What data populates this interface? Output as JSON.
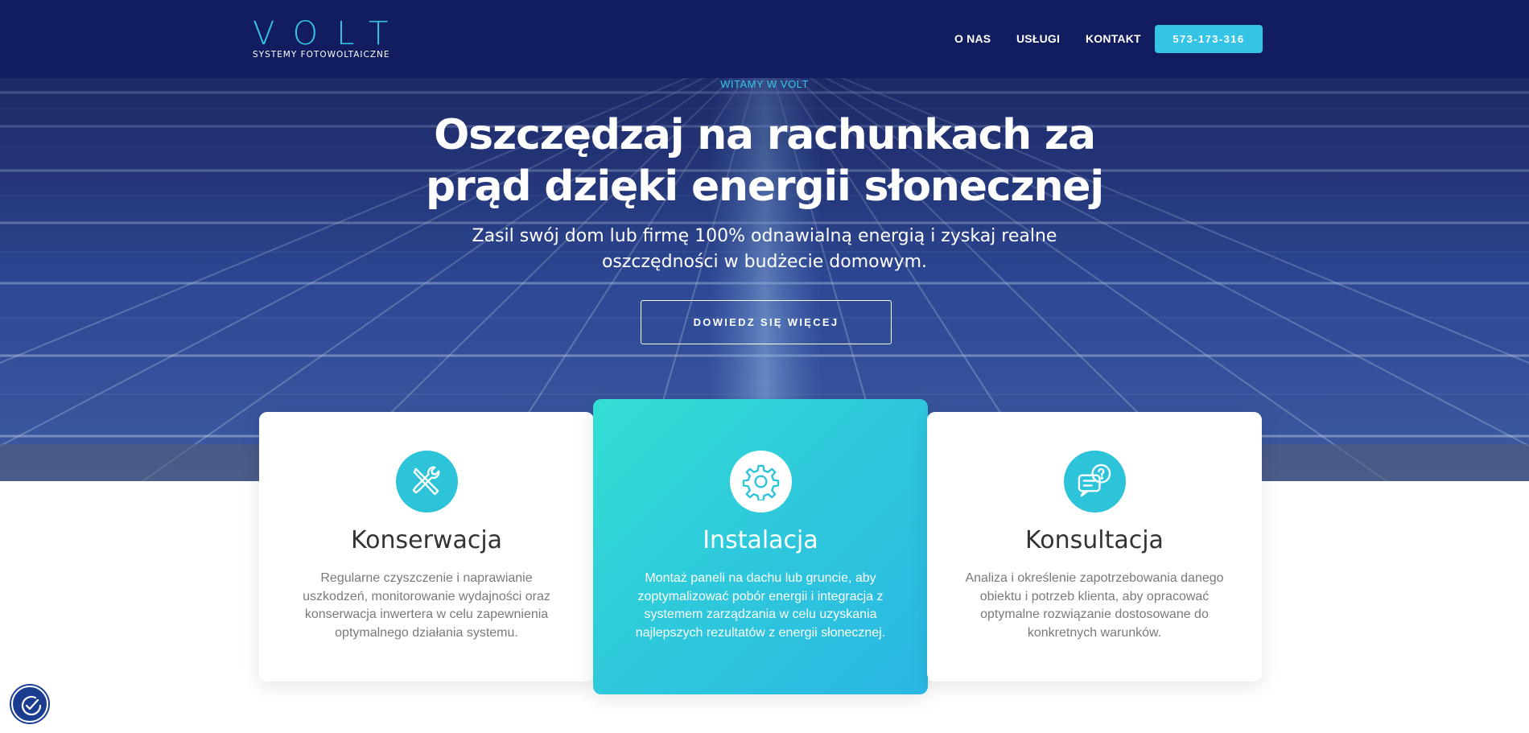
{
  "header": {
    "logo": {
      "word": "VOLT",
      "tagline": "SYSTEMY FOTOWOLTAICZNE"
    },
    "nav": [
      "O NAS",
      "USŁUGI",
      "KONTAKT"
    ],
    "phone_button": "573-173-316"
  },
  "hero": {
    "eyebrow": "WITAMY W VOLT",
    "title_line1": "Oszczędzaj na rachunkach za",
    "title_line2": "prąd dzięki energii słonecznej",
    "subtitle_line1": "Zasil swój dom lub firmę 100% odnawialną energią i zyskaj realne",
    "subtitle_line2": "oszczędności w budżecie domowym.",
    "cta": "DOWIEDZ SIĘ WIĘCEJ"
  },
  "cards": [
    {
      "icon": "tools-icon",
      "title": "Konserwacja",
      "text": "Regularne czyszczenie i naprawianie uszkodzeń, monitorowanie wydajności oraz konserwacja inwertera w celu zapewnienia optymalnego działania systemu."
    },
    {
      "icon": "gear-icon",
      "title": "Instalacja",
      "text": "Montaż paneli na dachu lub gruncie, aby zoptymalizować pobór energii i integracja z systemem zarządzania w celu uzyskania najlepszych rezultatów z energii słonecznej."
    },
    {
      "icon": "chat-question-icon",
      "title": "Konsultacja",
      "text": "Analiza i określenie zapotrzebowania danego obiektu i potrzeb klienta, aby opracować optymalne rozwiązanie dostosowane do konkretnych warunków."
    }
  ],
  "widget": {
    "icon": "accessibility-check-icon"
  },
  "colors": {
    "navy": "#111d5e",
    "accent": "#35c3e6",
    "teal_gradient_start": "#33dfd3",
    "teal_gradient_end": "#2bb7e3"
  }
}
